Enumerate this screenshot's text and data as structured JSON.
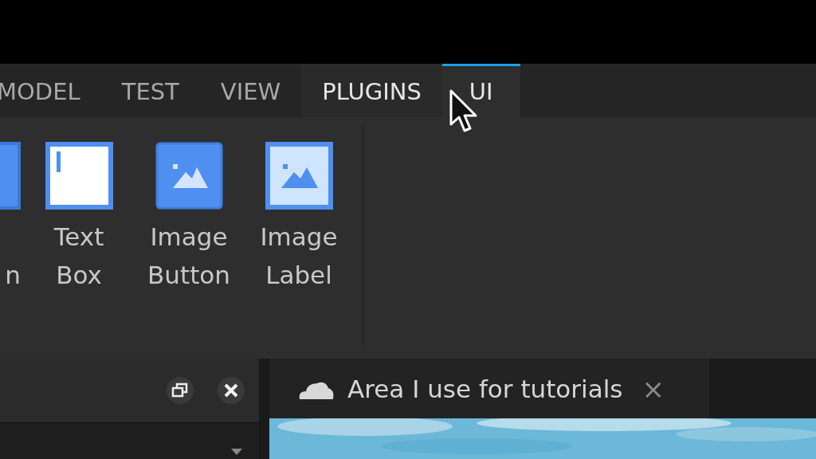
{
  "ribbon_tabs": [
    {
      "label": "MODEL",
      "selected": false,
      "hovered": false
    },
    {
      "label": "TEST",
      "selected": false,
      "hovered": false
    },
    {
      "label": "VIEW",
      "selected": false,
      "hovered": false
    },
    {
      "label": "PLUGINS",
      "selected": false,
      "hovered": true
    },
    {
      "label": "UI",
      "selected": true,
      "hovered": false
    }
  ],
  "ribbon_items": [
    {
      "kind": "text_button",
      "lines": [
        "n"
      ]
    },
    {
      "kind": "text_box",
      "lines": [
        "Text",
        "Box"
      ]
    },
    {
      "kind": "image_button",
      "lines": [
        "Image",
        "Button"
      ]
    },
    {
      "kind": "image_label",
      "lines": [
        "Image",
        "Label"
      ]
    }
  ],
  "document_tab": {
    "title": "Area I use for tutorials",
    "close": "×"
  }
}
